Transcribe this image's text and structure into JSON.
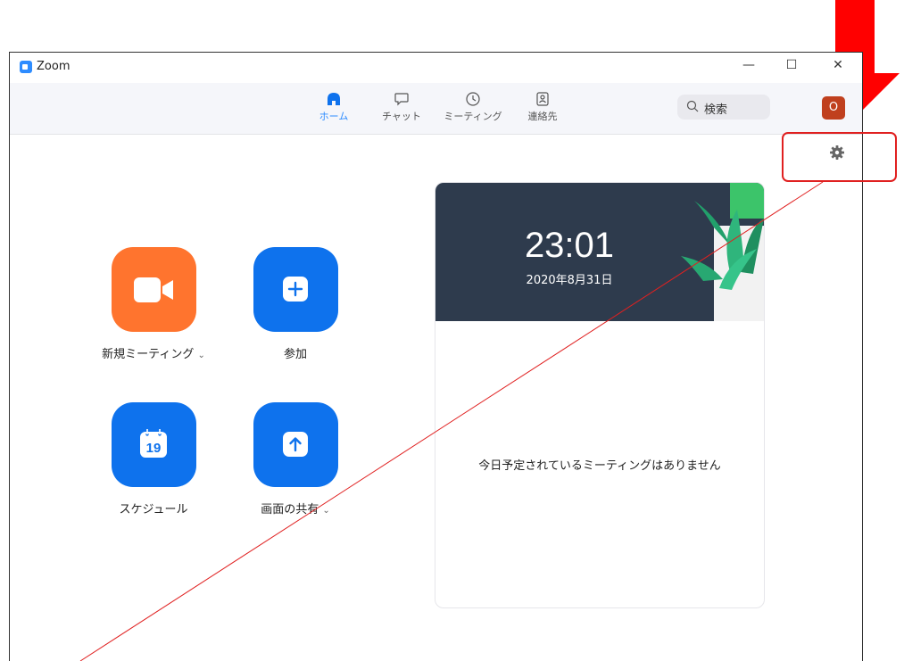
{
  "window": {
    "title": "Zoom",
    "controls": {
      "minimize": "—",
      "maximize": "☐",
      "close": "✕"
    }
  },
  "nav": {
    "tabs": [
      {
        "label": "ホーム",
        "icon": "home-icon",
        "active": true
      },
      {
        "label": "チャット",
        "icon": "chat-icon",
        "active": false
      },
      {
        "label": "ミーティング",
        "icon": "clock-icon",
        "active": false
      },
      {
        "label": "連絡先",
        "icon": "contacts-icon",
        "active": false
      }
    ],
    "search": {
      "label": "検索",
      "icon": "search-icon"
    },
    "avatar": {
      "text": "O",
      "color": "#c0401e"
    }
  },
  "settings": {
    "icon": "gear-icon"
  },
  "actions": [
    {
      "label": "新規ミーティング",
      "icon": "video-camera-icon",
      "color": "#ff742e",
      "has_dropdown": true
    },
    {
      "label": "参加",
      "icon": "plus-icon",
      "color": "#0e72ed",
      "has_dropdown": false
    },
    {
      "label": "スケジュール",
      "icon": "calendar-icon",
      "calendar_day": "19",
      "color": "#0e72ed",
      "has_dropdown": false
    },
    {
      "label": "画面の共有",
      "icon": "share-screen-icon",
      "color": "#0e72ed",
      "has_dropdown": true
    }
  ],
  "card": {
    "time": "23:01",
    "date": "2020年8月31日",
    "empty_message": "今日予定されているミーティングはありません"
  },
  "annotation": {
    "color": "#e02020"
  }
}
